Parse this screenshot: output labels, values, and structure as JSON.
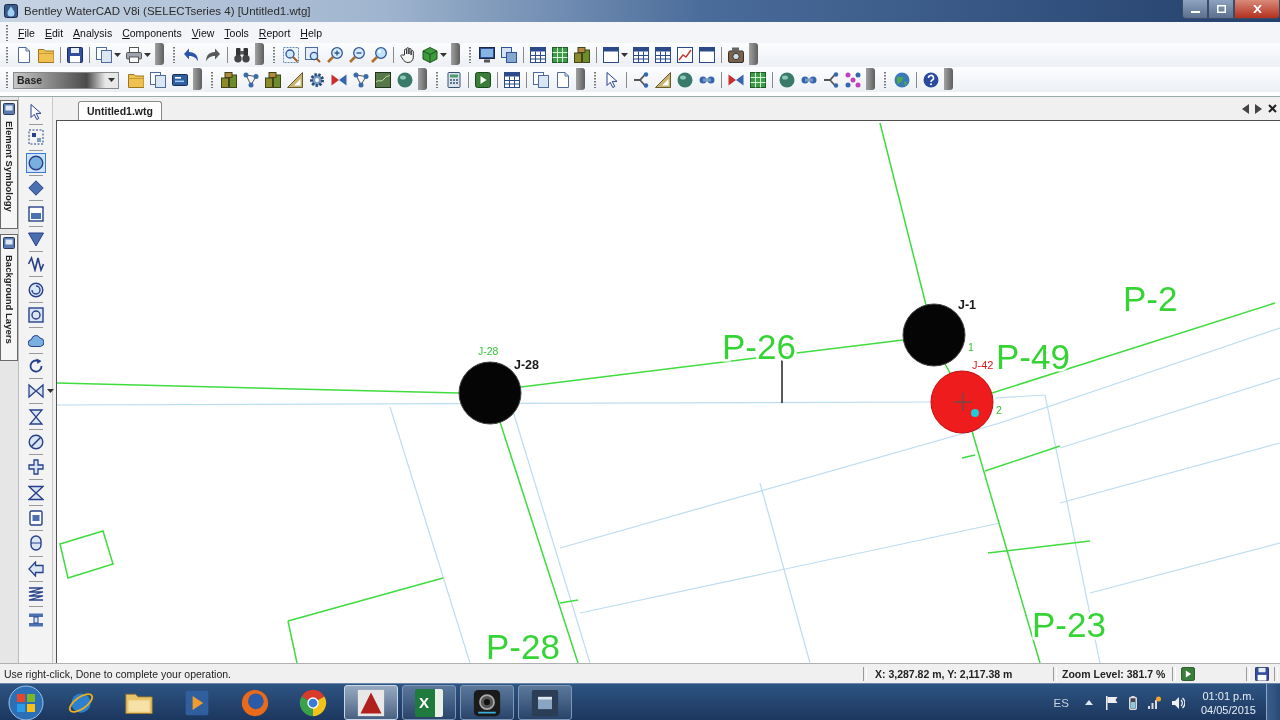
{
  "window": {
    "title": "Bentley WaterCAD V8i (SELECTseries 4) [Untitled1.wtg]"
  },
  "menu": [
    "File",
    "Edit",
    "Analysis",
    "Components",
    "View",
    "Tools",
    "Report",
    "Help"
  ],
  "toolbar": {
    "scenario": "Base"
  },
  "side_tabs": [
    "Element Symbology",
    "Background Layers"
  ],
  "palette": [
    {
      "selected": false
    },
    {
      "selected": false
    },
    {
      "selected": true
    },
    {
      "selected": false
    },
    {
      "selected": false
    },
    {
      "selected": false
    },
    {
      "selected": false
    },
    {
      "selected": false
    },
    {
      "selected": false
    },
    {
      "selected": false
    },
    {
      "selected": false
    },
    {
      "selected": false
    },
    {
      "selected": false
    },
    {
      "selected": false
    },
    {
      "selected": false
    },
    {
      "selected": false
    },
    {
      "selected": false
    },
    {
      "selected": false
    },
    {
      "selected": false
    },
    {
      "selected": false
    },
    {
      "selected": false
    }
  ],
  "document_tabs": [
    {
      "label": "Untitled1.wtg",
      "selected": true
    }
  ],
  "drawing": {
    "junctions": [
      {
        "label": "J-28",
        "selected": false
      },
      {
        "label": "J-1",
        "selected": false
      },
      {
        "label": "J-42",
        "selected": true
      }
    ],
    "pipes": [
      "P-26",
      "P-49",
      "P-2",
      "P-23",
      "P-28"
    ],
    "minor_labels": [
      "J-28",
      "1",
      "2"
    ]
  },
  "status_bar": {
    "message": "Use right-click, Done to complete your operation.",
    "coordinates": "X: 3,287.82 m, Y: 2,117.38 m",
    "zoom": "Zoom Level: 381.7 %"
  },
  "taskbar": {
    "apps": [
      {
        "running": false,
        "selected": false
      },
      {
        "running": false,
        "selected": false
      },
      {
        "running": false,
        "selected": false
      },
      {
        "running": false,
        "selected": false
      },
      {
        "running": false,
        "selected": false
      },
      {
        "running": true,
        "selected": true
      },
      {
        "running": true,
        "selected": false,
        "letter": "X"
      },
      {
        "running": true,
        "selected": false
      },
      {
        "running": true,
        "selected": false
      }
    ],
    "language": "ES",
    "time": "01:01 p.m.",
    "date": "04/05/2015"
  }
}
